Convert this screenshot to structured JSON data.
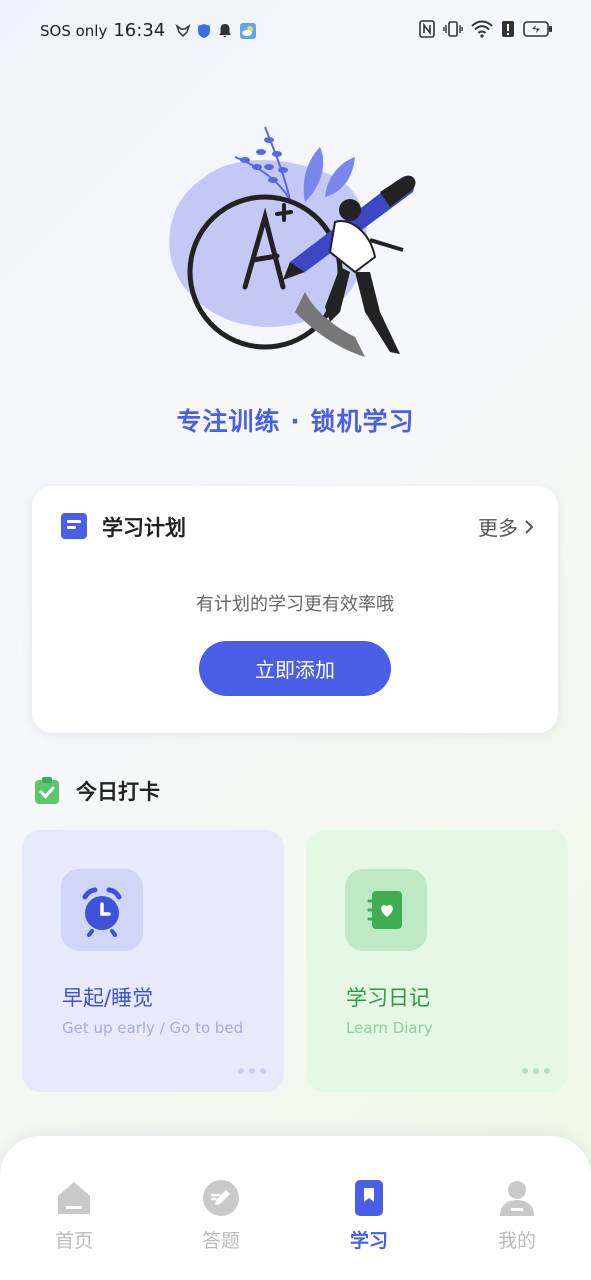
{
  "status_bar": {
    "carrier": "SOS only",
    "time": "16:34"
  },
  "hero": {
    "slogan": "专注训练 · 锁机学习",
    "illustration": "a-plus-grade-pen-illustration"
  },
  "plan": {
    "title": "学习计划",
    "more_label": "更多",
    "empty_text": "有计划的学习更有效率哦",
    "add_button": "立即添加",
    "icon": "document-icon"
  },
  "checkin": {
    "title": "今日打卡",
    "icon": "clipboard-check-icon",
    "cards": [
      {
        "title": "早起/睡觉",
        "subtitle": "Get up early / Go to bed",
        "icon": "alarm-clock-icon",
        "accent": "#3f51d9"
      },
      {
        "title": "学习日记",
        "subtitle": "Learn Diary",
        "icon": "diary-heart-icon",
        "accent": "#2f9a43"
      }
    ]
  },
  "tabbar": {
    "active_color": "#4a5ee8",
    "inactive_color": "#bcbcbc",
    "tabs": [
      {
        "label": "首页",
        "icon": "home-icon",
        "active": false
      },
      {
        "label": "答题",
        "icon": "pencil-icon",
        "active": false
      },
      {
        "label": "学习",
        "icon": "bookmark-icon",
        "active": true
      },
      {
        "label": "我的",
        "icon": "user-icon",
        "active": false
      }
    ]
  },
  "colors": {
    "primary": "#4a5ee8",
    "green": "#2f9a43"
  }
}
